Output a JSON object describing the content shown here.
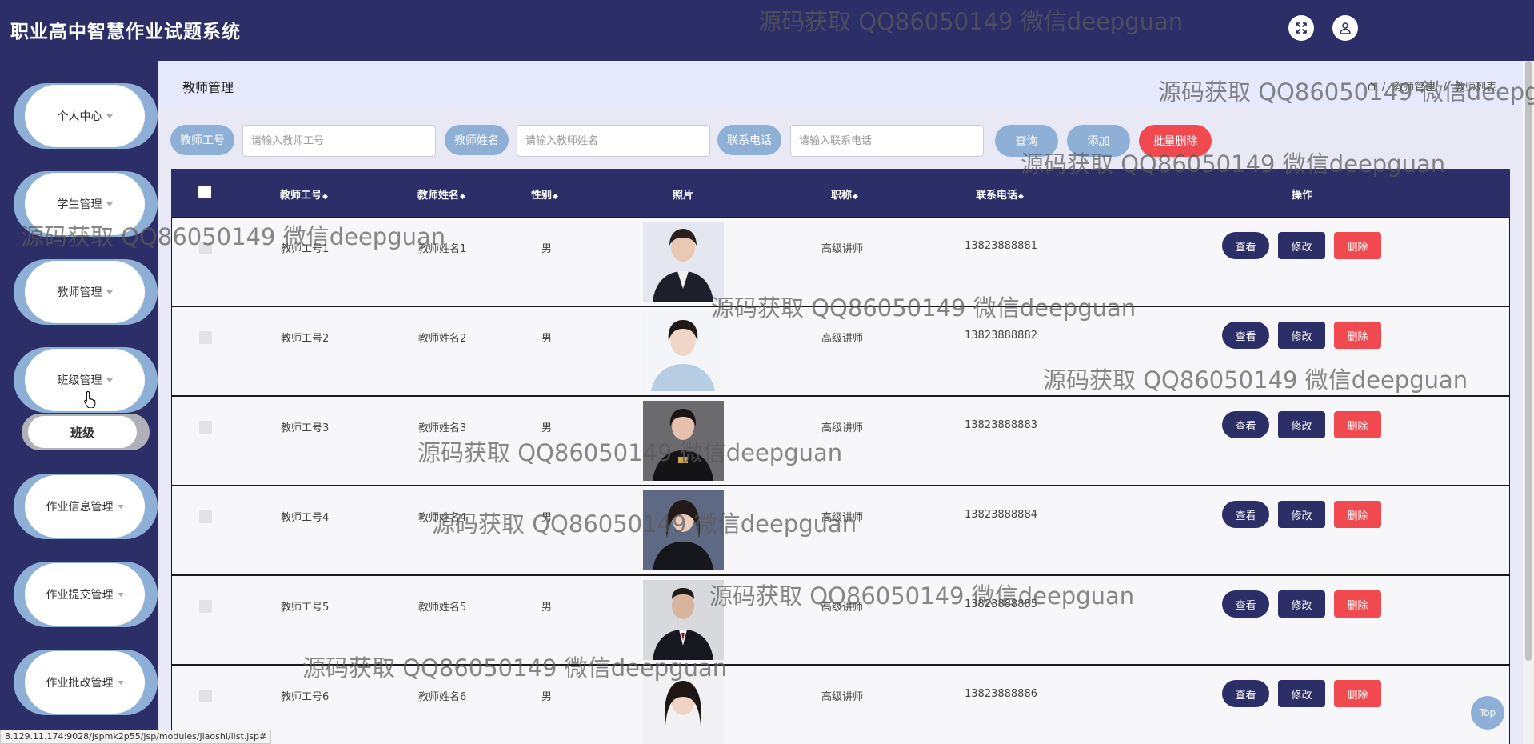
{
  "app": {
    "title": "职业高中智慧作业试题系统"
  },
  "header": {
    "fullscreen_icon": "expand-icon",
    "user_icon": "user-icon"
  },
  "sidebar": {
    "items": [
      {
        "label": "个人中心"
      },
      {
        "label": "学生管理"
      },
      {
        "label": "教师管理"
      },
      {
        "label": "班级管理"
      },
      {
        "label": "作业信息管理"
      },
      {
        "label": "作业提交管理"
      },
      {
        "label": "作业批改管理"
      }
    ],
    "submenu": {
      "label": "班级"
    }
  },
  "breadcrumb": {
    "title": "教师管理",
    "home_icon": "home-icon",
    "path": [
      "教师管理",
      "教师列表"
    ],
    "separator": "/"
  },
  "search": {
    "fields": [
      {
        "label": "教师工号",
        "placeholder": "请输入教师工号"
      },
      {
        "label": "教师姓名",
        "placeholder": "请输入教师姓名"
      },
      {
        "label": "联系电话",
        "placeholder": "请输入联系电话"
      }
    ],
    "query_label": "查询",
    "add_label": "添加",
    "batch_delete_label": "批量删除"
  },
  "table": {
    "columns": [
      "教师工号",
      "教师姓名",
      "性别",
      "照片",
      "职称",
      "联系电话",
      "操作"
    ],
    "sort_glyph": "◆",
    "actions": {
      "view": "查看",
      "edit": "修改",
      "delete": "删除"
    },
    "rows": [
      {
        "id": "教师工号1",
        "name": "教师姓名1",
        "gender": "男",
        "title": "高级讲师",
        "phone": "13823888881"
      },
      {
        "id": "教师工号2",
        "name": "教师姓名2",
        "gender": "男",
        "title": "高级讲师",
        "phone": "13823888882"
      },
      {
        "id": "教师工号3",
        "name": "教师姓名3",
        "gender": "男",
        "title": "高级讲师",
        "phone": "13823888883"
      },
      {
        "id": "教师工号4",
        "name": "教师姓名4",
        "gender": "男",
        "title": "高级讲师",
        "phone": "13823888884"
      },
      {
        "id": "教师工号5",
        "name": "教师姓名5",
        "gender": "男",
        "title": "高级讲师",
        "phone": "13823888885"
      },
      {
        "id": "教师工号6",
        "name": "教师姓名6",
        "gender": "男",
        "title": "高级讲师",
        "phone": "13823888886"
      }
    ]
  },
  "top_button": {
    "label": "Top"
  },
  "status_url": "8.129.11.174:9028/jspmk2p55/jsp/modules/jiaoshi/list.jsp#",
  "watermark": "源码获取 QQ86050149 微信deepguan",
  "colors": {
    "primary": "#2c2e68",
    "accent": "#8fb0d6",
    "danger": "#f04a50"
  }
}
